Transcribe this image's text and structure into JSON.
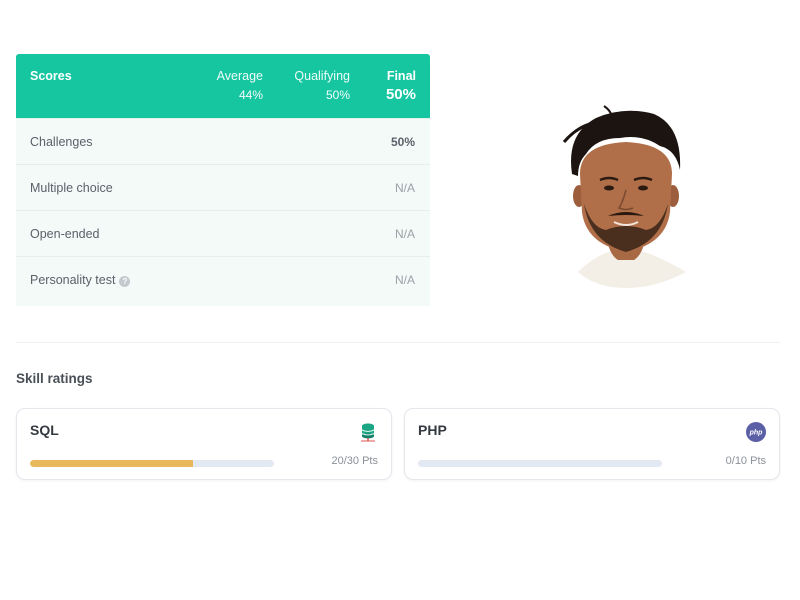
{
  "scores": {
    "header": {
      "title": "Scores",
      "average_label": "Average",
      "average_value": "44%",
      "qualifying_label": "Qualifying",
      "qualifying_value": "50%",
      "final_label": "Final",
      "final_value": "50%"
    },
    "rows": [
      {
        "name": "Challenges",
        "value": "50%"
      },
      {
        "name": "Multiple choice",
        "value": "N/A"
      },
      {
        "name": "Open-ended",
        "value": "N/A"
      },
      {
        "name": "Personality test",
        "value": "N/A"
      }
    ]
  },
  "skills": {
    "title": "Skill ratings",
    "items": [
      {
        "name": "SQL",
        "points": "20/30 Pts",
        "progress": 0.6667,
        "icon": "database-icon",
        "bar_color": "#e8b85a"
      },
      {
        "name": "PHP",
        "points": "0/10 Pts",
        "progress": 0,
        "icon": "php-icon",
        "bar_color": "#e8b85a"
      }
    ]
  },
  "colors": {
    "accent": "#16c6a1",
    "bar_track": "#e3e9f2",
    "bar_fill": "#e8b85a"
  }
}
